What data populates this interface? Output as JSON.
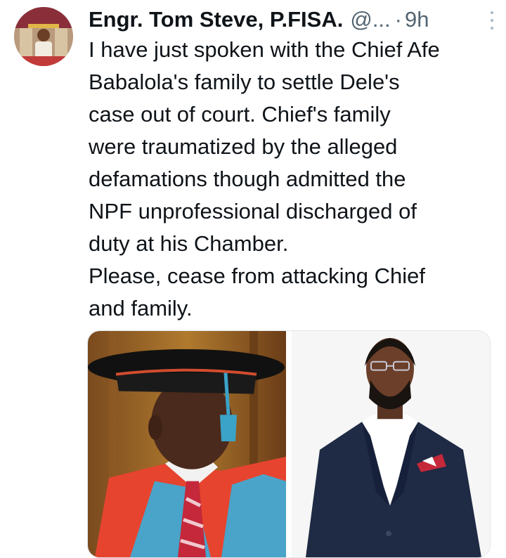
{
  "tweet": {
    "author_name": "Engr. Tom Steve, P.FISA.",
    "handle": "@...",
    "separator": "·",
    "time": "9h",
    "lines": [
      "I have just spoken with the Chief Afe",
      "Babalola's family to settle Dele's",
      "case out of court. Chief's family",
      "were traumatized by the alleged",
      "defamations though admitted the",
      "NPF unprofessional discharged of",
      "duty at his Chamber.",
      "Please, cease from attacking Chief",
      "and family."
    ]
  },
  "media": {
    "photos": [
      {
        "subject": "elderly man in academic cap and gown"
      },
      {
        "subject": "bearded man in navy suit"
      }
    ]
  },
  "icons": [
    "more-options-icon"
  ],
  "colors": {
    "text": "#0f1419",
    "muted": "#536471",
    "gown_red": "#e6442f",
    "gown_blue": "#4aa3c9",
    "suit_navy": "#1f2a44"
  }
}
